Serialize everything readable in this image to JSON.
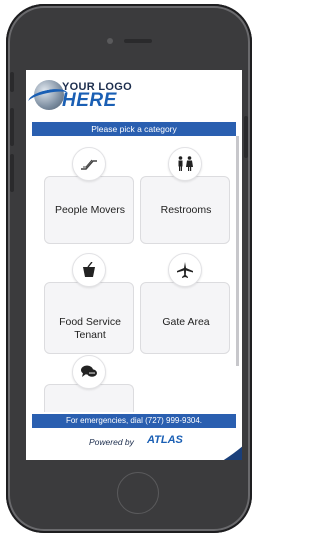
{
  "logo": {
    "line1": "YOUR LOGO",
    "line2": "HERE"
  },
  "header": {
    "title": "Please pick a category"
  },
  "categories": [
    {
      "label": "People Movers",
      "icon": "escalator-icon"
    },
    {
      "label": "Restrooms",
      "icon": "restroom-icon"
    },
    {
      "label": "Food Service Tenant",
      "icon": "food-cup-icon"
    },
    {
      "label": "Gate Area",
      "icon": "airplane-icon"
    },
    {
      "label": "",
      "icon": "chat-bubbles-icon"
    }
  ],
  "footer": {
    "emergency": "For emergencies, dial (727) 999-9304.",
    "powered_by": "Powered by",
    "brand": "ATLAS"
  },
  "colors": {
    "accent": "#2a5fb0",
    "phone": "#3b3b3d"
  }
}
